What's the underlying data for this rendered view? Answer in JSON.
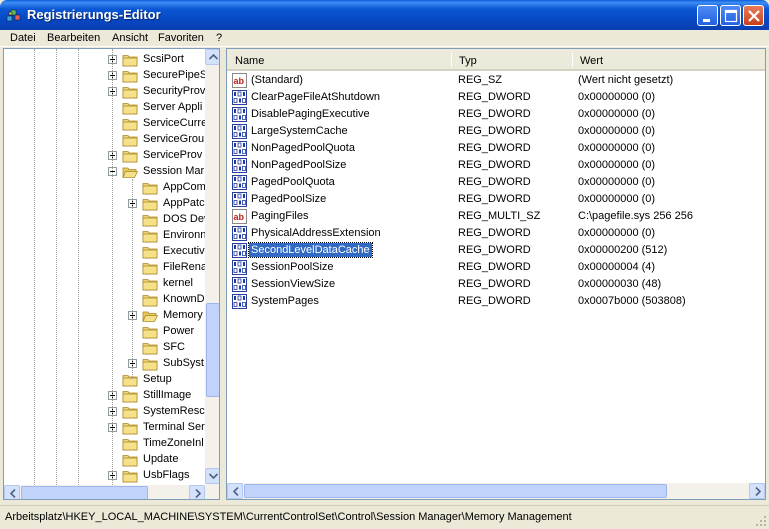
{
  "window": {
    "title": "Registrierungs-Editor",
    "minimize_icon": "minimize-icon",
    "maximize_icon": "maximize-icon",
    "close_icon": "close-icon"
  },
  "menu": [
    "Datei",
    "Bearbeiten",
    "Ansicht",
    "Favoriten",
    "?"
  ],
  "tree": {
    "items": [
      {
        "label": "ScsiPort",
        "level": 1,
        "expander": "plus"
      },
      {
        "label": "SecurePipeS",
        "level": 1,
        "expander": "plus"
      },
      {
        "label": "SecurityProv",
        "level": 1,
        "expander": "plus"
      },
      {
        "label": "Server Appli",
        "level": 1,
        "expander": "none"
      },
      {
        "label": "ServiceCurre",
        "level": 1,
        "expander": "none"
      },
      {
        "label": "ServiceGrou",
        "level": 1,
        "expander": "none"
      },
      {
        "label": "ServiceProv",
        "level": 1,
        "expander": "plus"
      },
      {
        "label": "Session Mar",
        "level": 1,
        "expander": "minus",
        "open": true
      },
      {
        "label": "AppCom",
        "level": 2,
        "expander": "none"
      },
      {
        "label": "AppPatc",
        "level": 2,
        "expander": "plus"
      },
      {
        "label": "DOS Dev",
        "level": 2,
        "expander": "none"
      },
      {
        "label": "Environn",
        "level": 2,
        "expander": "none"
      },
      {
        "label": "Executiv",
        "level": 2,
        "expander": "none"
      },
      {
        "label": "FileRena",
        "level": 2,
        "expander": "none"
      },
      {
        "label": "kernel",
        "level": 2,
        "expander": "none"
      },
      {
        "label": "KnownD",
        "level": 2,
        "expander": "none"
      },
      {
        "label": "Memory",
        "level": 2,
        "expander": "plus",
        "open": true
      },
      {
        "label": "Power",
        "level": 2,
        "expander": "none"
      },
      {
        "label": "SFC",
        "level": 2,
        "expander": "none"
      },
      {
        "label": "SubSyst",
        "level": 2,
        "expander": "plus"
      },
      {
        "label": "Setup",
        "level": 1,
        "expander": "none"
      },
      {
        "label": "StillImage",
        "level": 1,
        "expander": "plus"
      },
      {
        "label": "SystemResc",
        "level": 1,
        "expander": "plus"
      },
      {
        "label": "Terminal Ser",
        "level": 1,
        "expander": "plus"
      },
      {
        "label": "TimeZoneInl",
        "level": 1,
        "expander": "none"
      },
      {
        "label": "Update",
        "level": 1,
        "expander": "none"
      },
      {
        "label": "UsbFlags",
        "level": 1,
        "expander": "plus"
      }
    ]
  },
  "list": {
    "columns": [
      "Name",
      "Typ",
      "Wert"
    ],
    "rows": [
      {
        "name": "(Standard)",
        "type": "REG_SZ",
        "value": "(Wert nicht gesetzt)",
        "icon": "string-value-icon"
      },
      {
        "name": "ClearPageFileAtShutdown",
        "type": "REG_DWORD",
        "value": "0x00000000 (0)",
        "icon": "binary-value-icon"
      },
      {
        "name": "DisablePagingExecutive",
        "type": "REG_DWORD",
        "value": "0x00000000 (0)",
        "icon": "binary-value-icon"
      },
      {
        "name": "LargeSystemCache",
        "type": "REG_DWORD",
        "value": "0x00000000 (0)",
        "icon": "binary-value-icon"
      },
      {
        "name": "NonPagedPoolQuota",
        "type": "REG_DWORD",
        "value": "0x00000000 (0)",
        "icon": "binary-value-icon"
      },
      {
        "name": "NonPagedPoolSize",
        "type": "REG_DWORD",
        "value": "0x00000000 (0)",
        "icon": "binary-value-icon"
      },
      {
        "name": "PagedPoolQuota",
        "type": "REG_DWORD",
        "value": "0x00000000 (0)",
        "icon": "binary-value-icon"
      },
      {
        "name": "PagedPoolSize",
        "type": "REG_DWORD",
        "value": "0x00000000 (0)",
        "icon": "binary-value-icon"
      },
      {
        "name": "PagingFiles",
        "type": "REG_MULTI_SZ",
        "value": "C:\\pagefile.sys 256 256",
        "icon": "string-value-icon"
      },
      {
        "name": "PhysicalAddressExtension",
        "type": "REG_DWORD",
        "value": "0x00000000 (0)",
        "icon": "binary-value-icon"
      },
      {
        "name": "SecondLevelDataCache",
        "type": "REG_DWORD",
        "value": "0x00000200 (512)",
        "icon": "binary-value-icon",
        "selected": true
      },
      {
        "name": "SessionPoolSize",
        "type": "REG_DWORD",
        "value": "0x00000004 (4)",
        "icon": "binary-value-icon"
      },
      {
        "name": "SessionViewSize",
        "type": "REG_DWORD",
        "value": "0x00000030 (48)",
        "icon": "binary-value-icon"
      },
      {
        "name": "SystemPages",
        "type": "REG_DWORD",
        "value": "0x0007b000 (503808)",
        "icon": "binary-value-icon"
      }
    ]
  },
  "statusbar": {
    "path": "Arbeitsplatz\\HKEY_LOCAL_MACHINE\\SYSTEM\\CurrentControlSet\\Control\\Session Manager\\Memory Management"
  },
  "colors": {
    "titlebar": "#0a58d4",
    "selection": "#316ac5",
    "folder": "#f2d77a"
  }
}
